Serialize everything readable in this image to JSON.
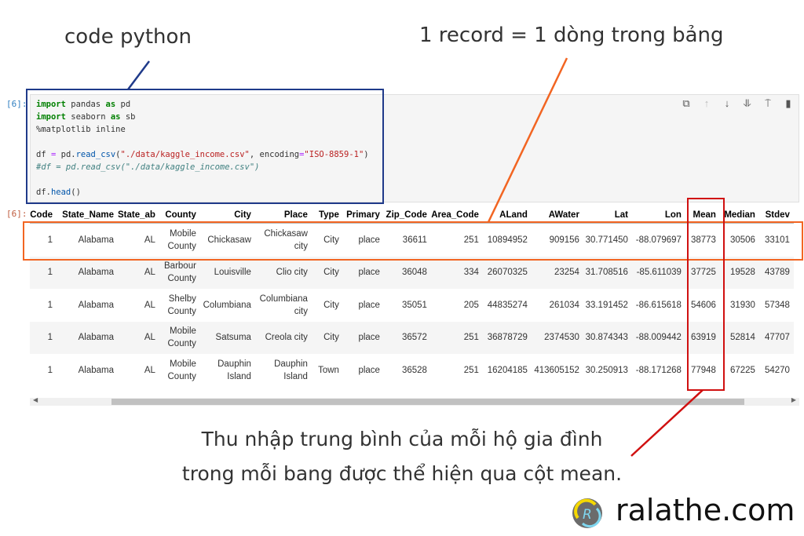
{
  "annotations": {
    "code_label": "code python",
    "record_label": "1 record = 1 dòng trong bảng",
    "mean_note_line1": "Thu nhập trung bình của mỗi hộ gia đình",
    "mean_note_line2": "trong mỗi bang được thể hiện qua cột mean."
  },
  "colors": {
    "code_box": "#1f3a8a",
    "record_box": "#f26522",
    "mean_box": "#d01010"
  },
  "cell": {
    "input_prompt": "[6]:",
    "output_prompt": "[6]:",
    "code_lines": [
      "import pandas as pd",
      "import seaborn as sb",
      "%matplotlib inline",
      "",
      "df = pd.read_csv(\"./data/kaggle_income.csv\", encoding=\"ISO-8859-1\")",
      "#df = pd.read_csv(\"./data/kaggle_income.csv\")",
      "",
      "df.head()"
    ],
    "toolbar": [
      "copy-icon",
      "move-up-icon",
      "move-down-icon",
      "insert-below-icon",
      "insert-above-icon",
      "delete-icon"
    ]
  },
  "table": {
    "columns": [
      "Code",
      "State_Name",
      "State_ab",
      "County",
      "City",
      "Place",
      "Type",
      "Primary",
      "Zip_Code",
      "Area_Code",
      "ALand",
      "AWater",
      "Lat",
      "Lon",
      "Mean",
      "Median",
      "Stdev"
    ],
    "rows": [
      [
        "1",
        "Alabama",
        "AL",
        "Mobile County",
        "Chickasaw",
        "Chickasaw city",
        "City",
        "place",
        "36611",
        "251",
        "10894952",
        "909156",
        "30.771450",
        "-88.079697",
        "38773",
        "30506",
        "33101"
      ],
      [
        "1",
        "Alabama",
        "AL",
        "Barbour County",
        "Louisville",
        "Clio city",
        "City",
        "place",
        "36048",
        "334",
        "26070325",
        "23254",
        "31.708516",
        "-85.611039",
        "37725",
        "19528",
        "43789"
      ],
      [
        "1",
        "Alabama",
        "AL",
        "Shelby County",
        "Columbiana",
        "Columbiana city",
        "City",
        "place",
        "35051",
        "205",
        "44835274",
        "261034",
        "33.191452",
        "-86.615618",
        "54606",
        "31930",
        "57348"
      ],
      [
        "1",
        "Alabama",
        "AL",
        "Mobile County",
        "Satsuma",
        "Creola city",
        "City",
        "place",
        "36572",
        "251",
        "36878729",
        "2374530",
        "30.874343",
        "-88.009442",
        "63919",
        "52814",
        "47707"
      ],
      [
        "1",
        "Alabama",
        "AL",
        "Mobile County",
        "Dauphin Island",
        "Dauphin Island",
        "Town",
        "place",
        "36528",
        "251",
        "16204185",
        "413605152",
        "30.250913",
        "-88.171268",
        "77948",
        "67225",
        "54270"
      ]
    ]
  },
  "brand": {
    "name": "ralathe.com"
  }
}
